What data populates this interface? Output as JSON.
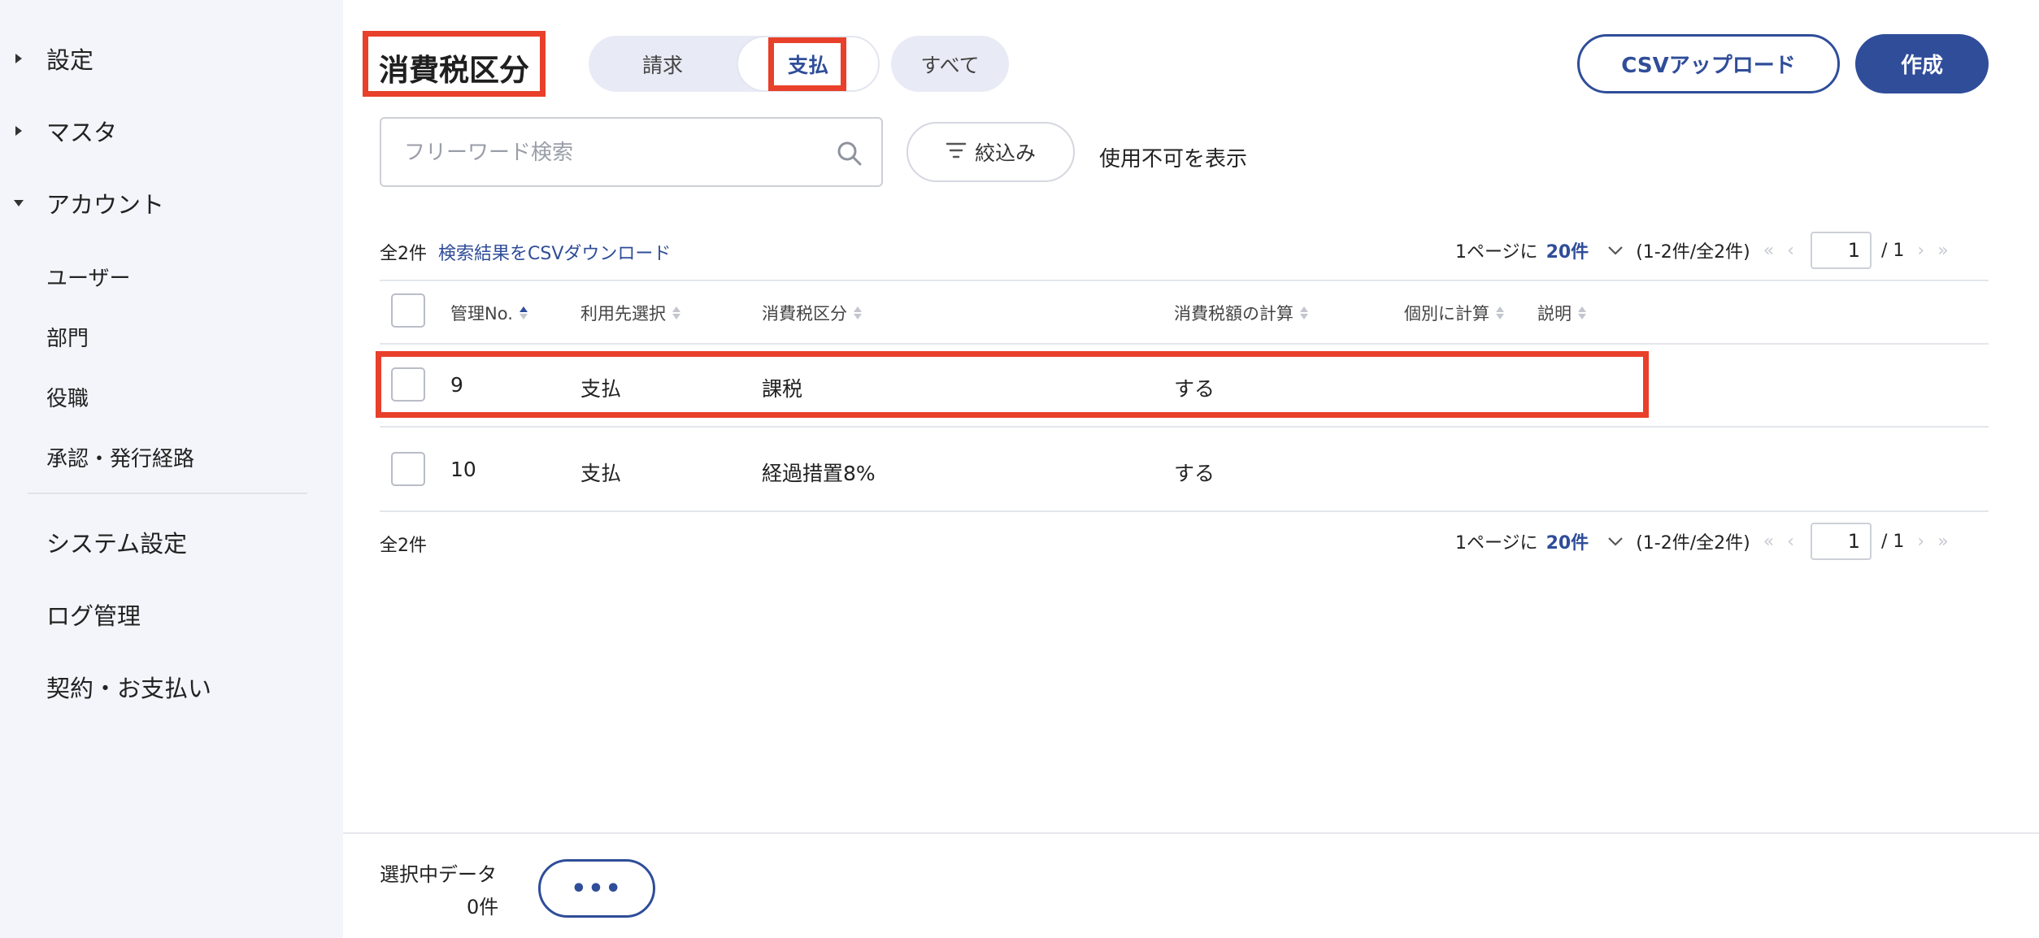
{
  "sidebar": {
    "groups": [
      {
        "label": "設定",
        "expanded": false
      },
      {
        "label": "マスタ",
        "expanded": false
      },
      {
        "label": "アカウント",
        "expanded": true
      }
    ],
    "account_items": [
      "ユーザー",
      "部門",
      "役職",
      "承認・発行経路"
    ],
    "main_items": [
      "システム設定",
      "ログ管理",
      "契約・お支払い"
    ]
  },
  "header": {
    "title": "消費税区分",
    "segments": {
      "billing": "請求",
      "payment": "支払",
      "all": "すべて",
      "selected": "支払"
    },
    "csv_upload": "CSVアップロード",
    "create": "作成"
  },
  "search": {
    "placeholder": "フリーワード検索",
    "value": ""
  },
  "filter": {
    "label": "絞込み"
  },
  "show_disabled": "使用不可を表示",
  "list": {
    "total_label": "全2件",
    "csv_download": "検索結果をCSVダウンロード",
    "pager": {
      "per_page_label": "1ページに",
      "per_page_value": "20件",
      "range": "(1-2件/全2件)",
      "page": "1",
      "total_pages": "/ 1",
      "first": "«",
      "prev": "‹",
      "next": "›",
      "last": "»"
    },
    "columns": [
      "管理No.",
      "利用先選択",
      "消費税区分",
      "消費税額の計算",
      "個別に計算",
      "説明"
    ],
    "rows": [
      {
        "no": "9",
        "usage": "支払",
        "category": "課税",
        "calc": "する",
        "individual": "",
        "description": ""
      },
      {
        "no": "10",
        "usage": "支払",
        "category": "経過措置8%",
        "calc": "する",
        "individual": "",
        "description": ""
      }
    ]
  },
  "footer": {
    "selected_label": "選択中データ",
    "selected_count": "0件",
    "more": "•••"
  },
  "colors": {
    "accent": "#2f4d99",
    "highlight": "#e8402a",
    "sidebar_bg": "#f4f5fa"
  }
}
